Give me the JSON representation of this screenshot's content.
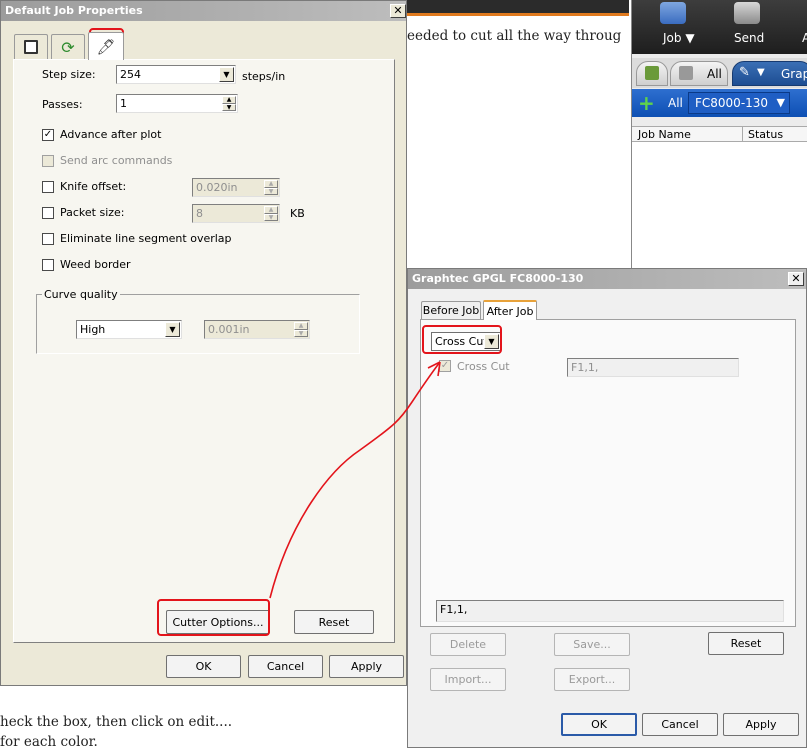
{
  "background": {
    "line_top": "eeded to cut all the way throug",
    "line_bottom1": "heck the box, then click on edit....",
    "line_bottom2": "for each color."
  },
  "app": {
    "job_label": "Job ▼",
    "send_label": "Send",
    "extra_label": "A",
    "tab_all": "All",
    "tab_graph": "Grap",
    "filter_all": "All",
    "device_name": "FC8000-130",
    "col_job_name": "Job Name",
    "col_status": "Status"
  },
  "job_props": {
    "title": "Default Job Properties",
    "step_size_label": "Step size:",
    "step_size_value": "254",
    "step_size_unit": "steps/in",
    "passes_label": "Passes:",
    "passes_value": "1",
    "advance_label": "Advance after plot",
    "send_arc_label": "Send arc commands",
    "knife_offset_label": "Knife offset:",
    "knife_offset_value": "0.020in",
    "packet_size_label": "Packet size:",
    "packet_size_value": "8",
    "packet_size_unit": "KB",
    "eliminate_label": "Eliminate line segment overlap",
    "weed_border_label": "Weed border",
    "curve_quality_label": "Curve quality",
    "curve_quality_value": "High",
    "curve_tolerance_value": "0.001in",
    "cutter_options_label": "Cutter Options...",
    "reset_label": "Reset",
    "ok_label": "OK",
    "cancel_label": "Cancel",
    "apply_label": "Apply"
  },
  "graphtec": {
    "title": "Graphtec GPGL FC8000-130",
    "tab_before": "Before Job",
    "tab_after": "After Job",
    "dropdown_value": "Cross Cut",
    "cross_cut_label": "Cross Cut",
    "command_value": "F1,1,",
    "preview_value": "F1,1,",
    "delete_label": "Delete",
    "save_label": "Save...",
    "reset_label": "Reset",
    "import_label": "Import...",
    "export_label": "Export...",
    "ok_label": "OK",
    "cancel_label": "Cancel",
    "apply_label": "Apply"
  },
  "colors": {
    "annotation": "#e3141b",
    "app_blue": "#0d4fb3",
    "toolbar_dark": "#1e1e1e"
  }
}
